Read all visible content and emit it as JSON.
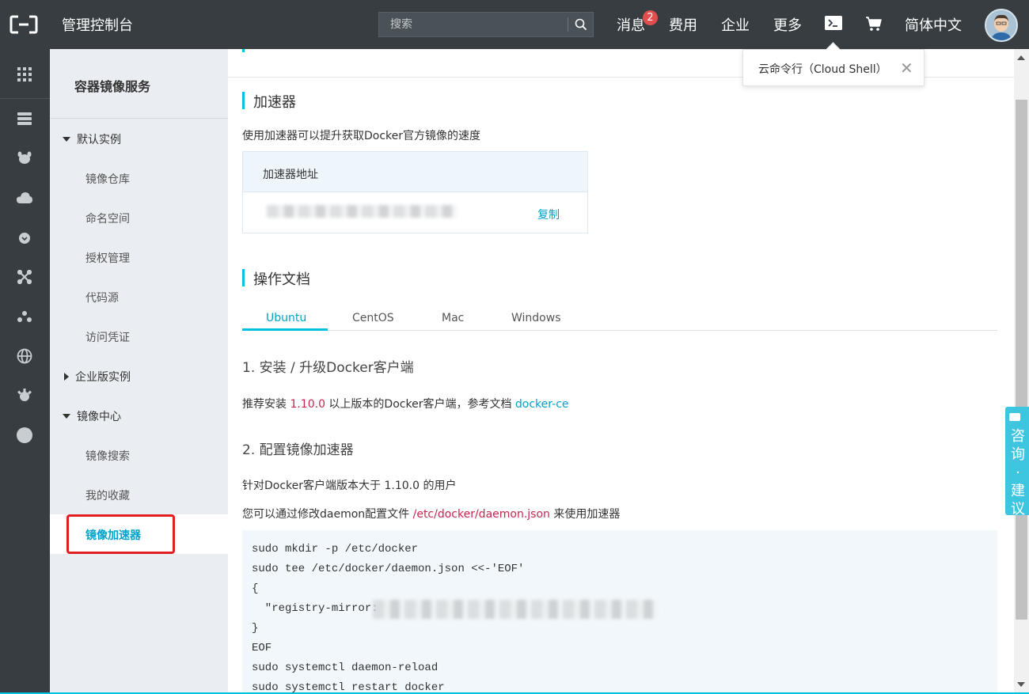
{
  "topbar": {
    "title": "管理控制台",
    "search_placeholder": "搜索",
    "nav": {
      "messages": "消息",
      "messages_badge": "2",
      "billing": "费用",
      "enterprise": "企业",
      "more": "更多",
      "language": "简体中文"
    }
  },
  "popover": {
    "text": "云命令行（Cloud Shell）",
    "close": "✕"
  },
  "sidebar": {
    "title": "容器镜像服务",
    "groups": [
      {
        "label": "默认实例",
        "items": [
          "镜像仓库",
          "命名空间",
          "授权管理",
          "代码源",
          "访问凭证"
        ]
      },
      {
        "label": "企业版实例"
      },
      {
        "label": "镜像中心",
        "items": [
          "镜像搜索",
          "我的收藏",
          "镜像加速器"
        ]
      }
    ]
  },
  "main": {
    "accelerator": {
      "title": "加速器",
      "description": "使用加速器可以提升获取Docker官方镜像的速度",
      "address_label": "加速器地址",
      "copy": "复制"
    },
    "docs": {
      "title": "操作文档",
      "tabs": [
        "Ubuntu",
        "CentOS",
        "Mac",
        "Windows"
      ],
      "step1": {
        "title": "1. 安装 / 升级Docker客户端",
        "text_before": "推荐安装 ",
        "version": "1.10.0",
        "text_after": " 以上版本的Docker客户端，参考文档 ",
        "link": "docker-ce"
      },
      "step2": {
        "title": "2. 配置镜像加速器",
        "line1": "针对Docker客户端版本大于 1.10.0 的用户",
        "line2_before": "您可以通过修改daemon配置文件 ",
        "line2_path": "/etc/docker/daemon.json",
        "line2_after": " 来使用加速器"
      },
      "code": [
        "sudo mkdir -p /etc/docker",
        "sudo tee /etc/docker/daemon.json <<-'EOF'",
        "{",
        "  \"registry-mirror:",
        "}",
        "EOF",
        "sudo systemctl daemon-reload",
        "sudo systemctl restart docker"
      ]
    }
  },
  "consult": {
    "text": "咨询·建议"
  },
  "colors": {
    "topbar": "#373d41",
    "accent": "#00c1de",
    "link": "#00a2ca",
    "sidebar": "#eaedf1",
    "highlight_red": "#c7254e"
  }
}
